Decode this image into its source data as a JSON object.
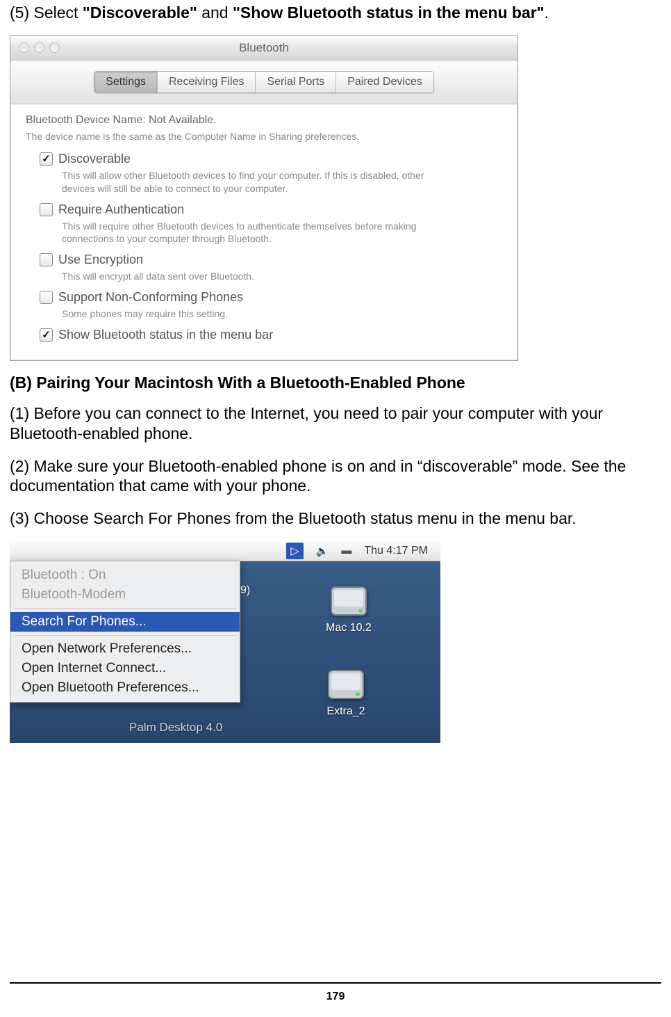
{
  "step5": {
    "prefix": "(5) Select ",
    "bold1": "\"Discoverable\"",
    "mid": " and ",
    "bold2": "\"Show Bluetooth status in the menu bar\"",
    "suffix": "."
  },
  "bt_window": {
    "title": "Bluetooth",
    "tabs": {
      "settings": "Settings",
      "receiving": "Receiving Files",
      "serial": "Serial Ports",
      "paired": "Paired Devices"
    },
    "device_name_line": "Bluetooth Device Name:  Not Available.",
    "device_name_sub": "The device name is the same as the Computer Name in Sharing preferences.",
    "options": {
      "discoverable": {
        "label": "Discoverable",
        "checked": true,
        "desc": "This will allow other Bluetooth devices to find your computer.  If this is disabled, other devices will still be able to connect to your computer."
      },
      "require_auth": {
        "label": "Require Authentication",
        "checked": false,
        "desc": "This will require other Bluetooth devices to authenticate themselves before making connections to your computer through Bluetooth."
      },
      "use_encryption": {
        "label": "Use Encryption",
        "checked": false,
        "desc": "This will encrypt all data sent over Bluetooth."
      },
      "support_phones": {
        "label": "Support Non-Conforming Phones",
        "checked": false,
        "desc": "Some phones may require this setting."
      },
      "show_status": {
        "label": "Show Bluetooth status in the menu bar",
        "checked": true
      }
    }
  },
  "section_b_heading": "(B) Pairing Your Macintosh With a Bluetooth-Enabled Phone",
  "para1": "(1) Before you can connect to the Internet, you need to pair your computer with your Bluetooth-enabled phone.",
  "para2": "(2) Make sure your Bluetooth-enabled phone is on and in “discoverable” mode. See the documentation that came with your phone.",
  "para3": "(3) Choose Search For Phones from the Bluetooth status menu in the menu bar.",
  "menubar": {
    "bt_glyph": "▷",
    "volume_glyph": "🔈",
    "battery_glyph": "▬",
    "clock": "Thu 4:17 PM"
  },
  "dropdown": {
    "status": "Bluetooth : On",
    "modem": "Bluetooth-Modem",
    "search": "Search For Phones...",
    "net_prefs": "Open Network Preferences...",
    "inet_connect": "Open Internet Connect...",
    "bt_prefs": "Open Bluetooth Preferences..."
  },
  "desktop": {
    "cut_label": "9)",
    "disk1": "Mac 10.2",
    "disk2": "Extra_2",
    "bottom_label": "Palm Desktop 4.0"
  },
  "page_number": "179"
}
